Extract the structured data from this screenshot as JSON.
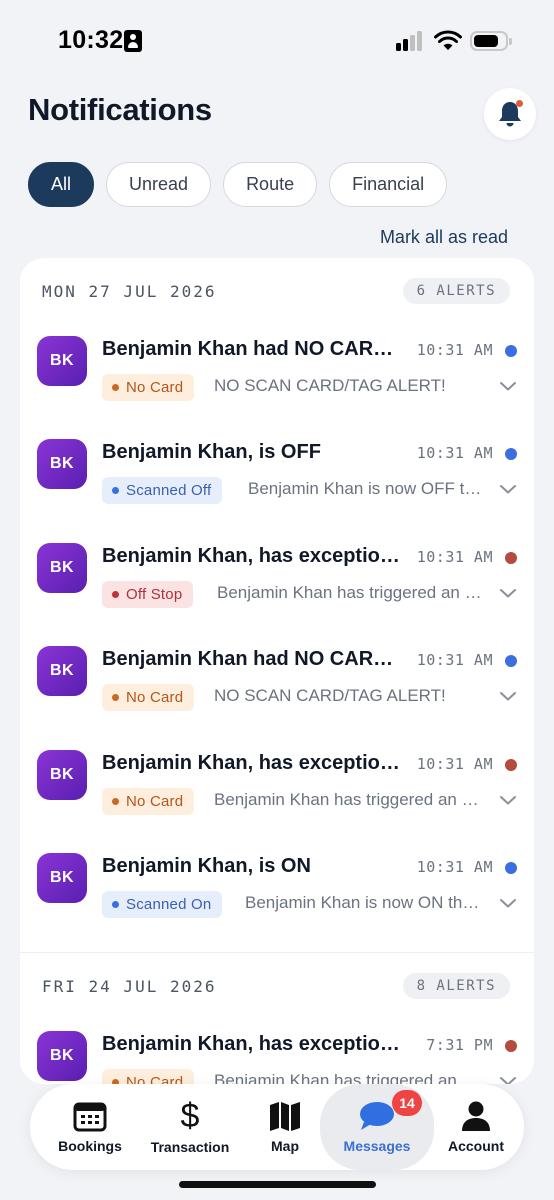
{
  "status_bar": {
    "time": "10:32"
  },
  "header": {
    "title": "Notifications"
  },
  "filters": [
    {
      "label": "All",
      "active": true
    },
    {
      "label": "Unread",
      "active": false
    },
    {
      "label": "Route",
      "active": false
    },
    {
      "label": "Financial",
      "active": false
    }
  ],
  "mark_all_read": "Mark all as read",
  "sections": [
    {
      "date": "MON 27 JUL 2026",
      "count": "6 ALERTS",
      "items": [
        {
          "initials": "BK",
          "title": "Benjamin Khan had NO CARD SCAN",
          "time": "10:31 AM",
          "dot": "#3b6fe0",
          "tag": "No Card",
          "tag_kind": "orange",
          "preview": "NO SCAN CARD/TAG ALERT!"
        },
        {
          "initials": "BK",
          "title": "Benjamin Khan, is OFF",
          "time": "10:31 AM",
          "dot": "#3b6fe0",
          "tag": "Scanned Off",
          "tag_kind": "blue",
          "preview": "Benjamin Khan is now OFF the bus"
        },
        {
          "initials": "BK",
          "title": "Benjamin Khan, has exception alert",
          "time": "10:31 AM",
          "dot": "#b54a3f",
          "tag": "Off Stop",
          "tag_kind": "red",
          "preview": "Benjamin Khan has triggered an alert"
        },
        {
          "initials": "BK",
          "title": "Benjamin Khan had NO CARD SCAN",
          "time": "10:31 AM",
          "dot": "#3b6fe0",
          "tag": "No Card",
          "tag_kind": "orange",
          "preview": "NO SCAN CARD/TAG ALERT!"
        },
        {
          "initials": "BK",
          "title": "Benjamin Khan, has exception alert",
          "time": "10:31 AM",
          "dot": "#b54a3f",
          "tag": "No Card",
          "tag_kind": "orange",
          "preview": "Benjamin Khan has triggered an alert"
        },
        {
          "initials": "BK",
          "title": "Benjamin Khan, is ON",
          "time": "10:31 AM",
          "dot": "#3b6fe0",
          "tag": "Scanned On",
          "tag_kind": "blue",
          "preview": "Benjamin Khan is now ON the bus"
        }
      ]
    },
    {
      "date": "FRI 24 JUL 2026",
      "count": "8 ALERTS",
      "items": [
        {
          "initials": "BK",
          "title": "Benjamin Khan, has exception alert",
          "time": "7:31 PM",
          "dot": "#b54a3f",
          "tag": "No Card",
          "tag_kind": "orange",
          "preview": "Benjamin Khan has triggered an alert"
        }
      ]
    }
  ],
  "tabbar": [
    {
      "label": "Bookings",
      "icon": "calendar-icon",
      "active": false
    },
    {
      "label": "Transaction",
      "icon": "dollar-icon",
      "active": false
    },
    {
      "label": "Map",
      "icon": "map-icon",
      "active": false
    },
    {
      "label": "Messages",
      "icon": "chat-icon",
      "active": true,
      "badge": "14"
    },
    {
      "label": "Account",
      "icon": "person-icon",
      "active": false
    }
  ],
  "colors": {
    "primary": "#1b3a5c",
    "active_tab": "#3b6fd6",
    "unread_dot": "#3b6fe0",
    "alert_dot": "#b54a3f",
    "badge": "#ef4444"
  }
}
